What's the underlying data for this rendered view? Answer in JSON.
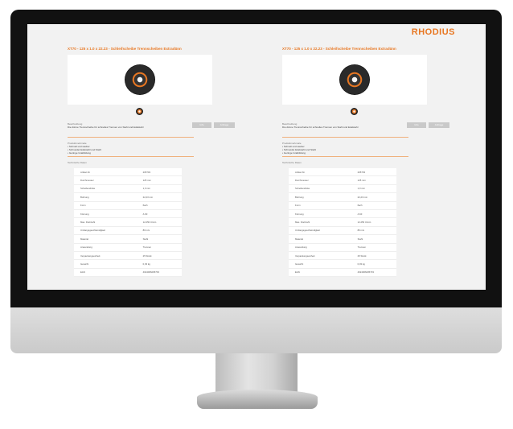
{
  "brand": "RHODIUS",
  "panels": [
    {
      "title": "XT70 - 125 x 1.0 x 22.23 - Schleifscheibe Trennscheiben Extradünn",
      "description_label": "Beschreibung",
      "description": "Die dünne Trennscheibe für schnelles Trennen von Stahl und Edelstahl",
      "buttons": [
        "Info",
        "Anfrage"
      ],
      "features_label": "Produktmerkmale",
      "features": [
        "Schnell und sauber",
        "Schneidet Edelstahl und Stahl",
        "Geringe Gratbildung"
      ],
      "specs_label": "Technische Daten",
      "specs": [
        [
          "Artikel-Nr.",
          "205703"
        ],
        [
          "Durchmesser",
          "125 mm"
        ],
        [
          "Scheibendicke",
          "1,0 mm"
        ],
        [
          "Bohrung",
          "22,23 mm"
        ],
        [
          "Form",
          "flach"
        ],
        [
          "Körnung",
          "A 60"
        ],
        [
          "Max. Drehzahl",
          "12.250 U/min"
        ],
        [
          "Umfangsgeschwindigkeit",
          "80 m/s"
        ],
        [
          "Material",
          "Stahl"
        ],
        [
          "Anwendung",
          "Trennen"
        ],
        [
          "Verpackungseinheit",
          "25 Stück"
        ],
        [
          "Gewicht",
          "0,03 kg"
        ],
        [
          "EAN",
          "4024006205703"
        ]
      ]
    },
    {
      "title": "XT70 - 125 x 1.0 x 22.23 - Schleifscheibe Trennscheiben Extradünn",
      "description_label": "Beschreibung",
      "description": "Die dünne Trennscheibe für schnelles Trennen von Stahl und Edelstahl",
      "buttons": [
        "Info",
        "Anfrage"
      ],
      "features_label": "Produktmerkmale",
      "features": [
        "Schnell und sauber",
        "Schneidet Edelstahl und Stahl",
        "Geringe Gratbildung"
      ],
      "specs_label": "Technische Daten",
      "specs": [
        [
          "Artikel-Nr.",
          "205703"
        ],
        [
          "Durchmesser",
          "125 mm"
        ],
        [
          "Scheibendicke",
          "1,0 mm"
        ],
        [
          "Bohrung",
          "22,23 mm"
        ],
        [
          "Form",
          "flach"
        ],
        [
          "Körnung",
          "A 60"
        ],
        [
          "Max. Drehzahl",
          "12.250 U/min"
        ],
        [
          "Umfangsgeschwindigkeit",
          "80 m/s"
        ],
        [
          "Material",
          "Stahl"
        ],
        [
          "Anwendung",
          "Trennen"
        ],
        [
          "Verpackungseinheit",
          "25 Stück"
        ],
        [
          "Gewicht",
          "0,03 kg"
        ],
        [
          "EAN",
          "4024006205703"
        ]
      ]
    }
  ],
  "colors": {
    "accent": "#e87722",
    "bezel": "#111111",
    "screen_bg": "#f2f2f2"
  }
}
